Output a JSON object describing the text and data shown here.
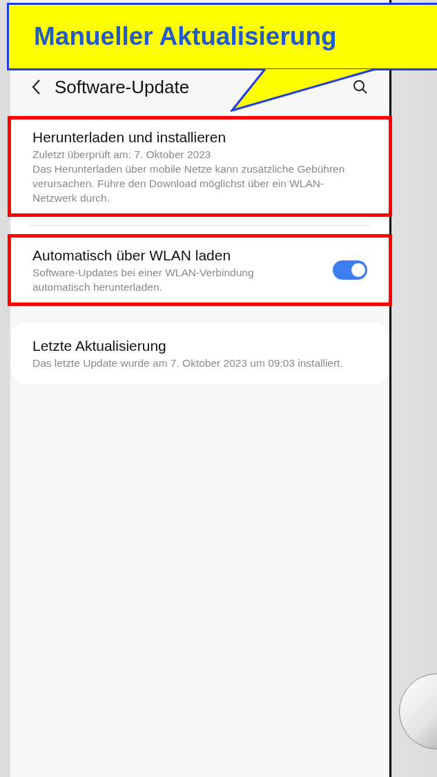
{
  "callout": {
    "text": "Manueller Aktualisierung"
  },
  "header": {
    "title": "Software-Update"
  },
  "cards": [
    {
      "items": [
        {
          "kind": "action",
          "title": "Herunterladen und installieren",
          "texts": [
            "Zuletzt überprüft am: 7. Oktober 2023",
            "Das Herunterladen über mobile Netze kann zusätzliche Gebühren verursachen. Führe den Download möglichst über ein WLAN-Netzwerk durch."
          ],
          "highlighted": true
        },
        {
          "kind": "toggle",
          "title": "Automatisch über WLAN laden",
          "texts": [
            "Software-Updates bei einer WLAN-Verbindung automatisch herunterladen."
          ],
          "on": true,
          "highlighted": true
        }
      ]
    },
    {
      "items": [
        {
          "kind": "action",
          "title": "Letzte Aktualisierung",
          "texts": [
            "Das letzte Update wurde am 7. Oktober 2023 um 09:03 installiert."
          ],
          "highlighted": false
        }
      ]
    }
  ]
}
